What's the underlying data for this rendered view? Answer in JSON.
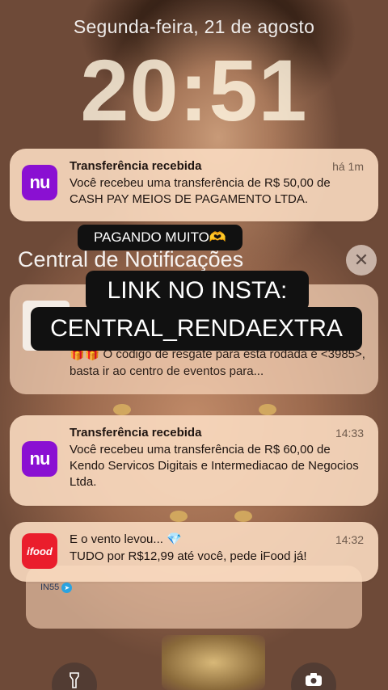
{
  "lockscreen": {
    "date": "Segunda-feira, 21 de agosto",
    "time": "20:51"
  },
  "notifications": [
    {
      "app_icon": "nu",
      "title": "Transferência recebida",
      "time": "há 1m",
      "body": "Você recebeu uma transferência de R$ 50,00 de CASH PAY MEIOS DE PAGAMENTO LTDA."
    },
    {
      "app_icon": "nu",
      "title": "Transferência recebida",
      "time": "14:33",
      "body": "Você recebeu uma transferência de R$ 60,00 de Kendo Servicos Digitais e Intermediacao de Negocios Ltda."
    },
    {
      "app_icon": "ifood",
      "title": "E o vento levou... 💎",
      "time": "14:32",
      "body": "TUDO por R$12,99 até você, pede iFood já!"
    }
  ],
  "hidden_notification": {
    "body": "🎁🎁 O código de resgate para esta rodada é <3985>, basta ir ao centro de eventos para..."
  },
  "notification_center": {
    "header": "Central de Notificações",
    "close_icon": "close-icon"
  },
  "overlays": {
    "tag_small": "PAGANDO MUITO🫶",
    "link_line1": "LINK NO INSTA:",
    "link_line2": "CENTRAL_RENDAEXTRA"
  },
  "back_card": {
    "badge": "IN55"
  },
  "bottom_controls": {
    "flashlight_icon": "flashlight-icon",
    "camera_icon": "camera-icon"
  },
  "colors": {
    "nubank": "#8a10d2",
    "ifood": "#ea1d2c",
    "overlay_tag": "#111111"
  }
}
